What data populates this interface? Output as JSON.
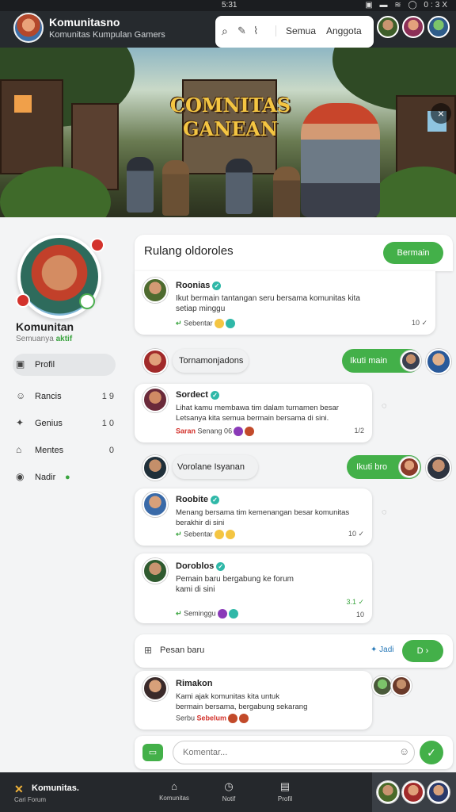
{
  "status_bar": {
    "time": "5:31",
    "right": "▣ ▬ ≋ ◯ 0:3X"
  },
  "header": {
    "title": "Komunitasnо",
    "subtitle": "Komunitas Kumpulan Gamers",
    "search_icon": "search-icon",
    "tab_1": "Semua",
    "tab_2": "Anggota"
  },
  "banner": {
    "title_line1": "COMNITAS",
    "title_line2": "GANEAN",
    "close_label": "×"
  },
  "sidebar": {
    "profile_name": "Komunitan",
    "profile_status": "Semuanya",
    "profile_status_badge": "aktif",
    "items": [
      {
        "icon": "▣",
        "label": "Profil",
        "count": ""
      },
      {
        "icon": "☺",
        "label": "Rancis",
        "count": "1 9"
      },
      {
        "icon": "✦",
        "label": "Genius",
        "count": "1 0"
      },
      {
        "icon": "⌂",
        "label": "Mentes",
        "count": "0"
      },
      {
        "icon": "◉",
        "label": "Nadir",
        "count": "●"
      }
    ]
  },
  "feed": {
    "title": "Rulang oldoroles",
    "action_label": "Bermain",
    "posts": [
      {
        "name": "Roonias",
        "text": "Ikut bermain tantangan seru bersama komunitas kita\nsetiap minggu",
        "foot": "Sebentar",
        "meta": "10 ✓"
      },
      {
        "name": "Sordect",
        "text": "Lihat kamu membawa tim dalam turnamen besar\nLetsanya kita semua bermain bersama di sini.",
        "foot_red": "Saran",
        "foot": "Senang 06",
        "meta": "1/2"
      },
      {
        "name": "Roobite",
        "text": "Menang bersama tim kemenangan besar komunitas\nberakhir di sini",
        "foot": "Sebentar",
        "meta": "10 ✓"
      },
      {
        "name": "Doroblos",
        "text": "Pemain baru bergabung ke forum\nkami di sini",
        "foot": "Seminggu",
        "meta_top": "3.1 ✓",
        "meta": "10"
      },
      {
        "name": "Rimakon",
        "text": "Kami ajak komunitas kita untuk\nbermain bersama, bergabung sekarang",
        "foot_red": "Serbu",
        "foot": "Sebelum",
        "meta": ""
      }
    ],
    "chips": [
      {
        "label": "Tornamonjadons",
        "action": "Ikuti main"
      },
      {
        "label": "Vorolane Isyanan",
        "action": "Ikuti bro"
      }
    ],
    "composer_label": "Pesan baru",
    "composer_aside": "Jadi",
    "composer_button": "D",
    "input_placeholder": "Komentar..."
  },
  "bottom_bar": {
    "title": "Komunitas.",
    "subtitle": "Cari Forum",
    "tabs": [
      {
        "icon": "⌂",
        "label": "Komunitas"
      },
      {
        "icon": "◷",
        "label": "Notif"
      },
      {
        "icon": "▤",
        "label": "Profil"
      }
    ]
  },
  "colors": {
    "accent_green": "#43b049",
    "verify_teal": "#2fb8a8",
    "alert_red": "#d3322c",
    "header_dark": "#262a2e"
  }
}
